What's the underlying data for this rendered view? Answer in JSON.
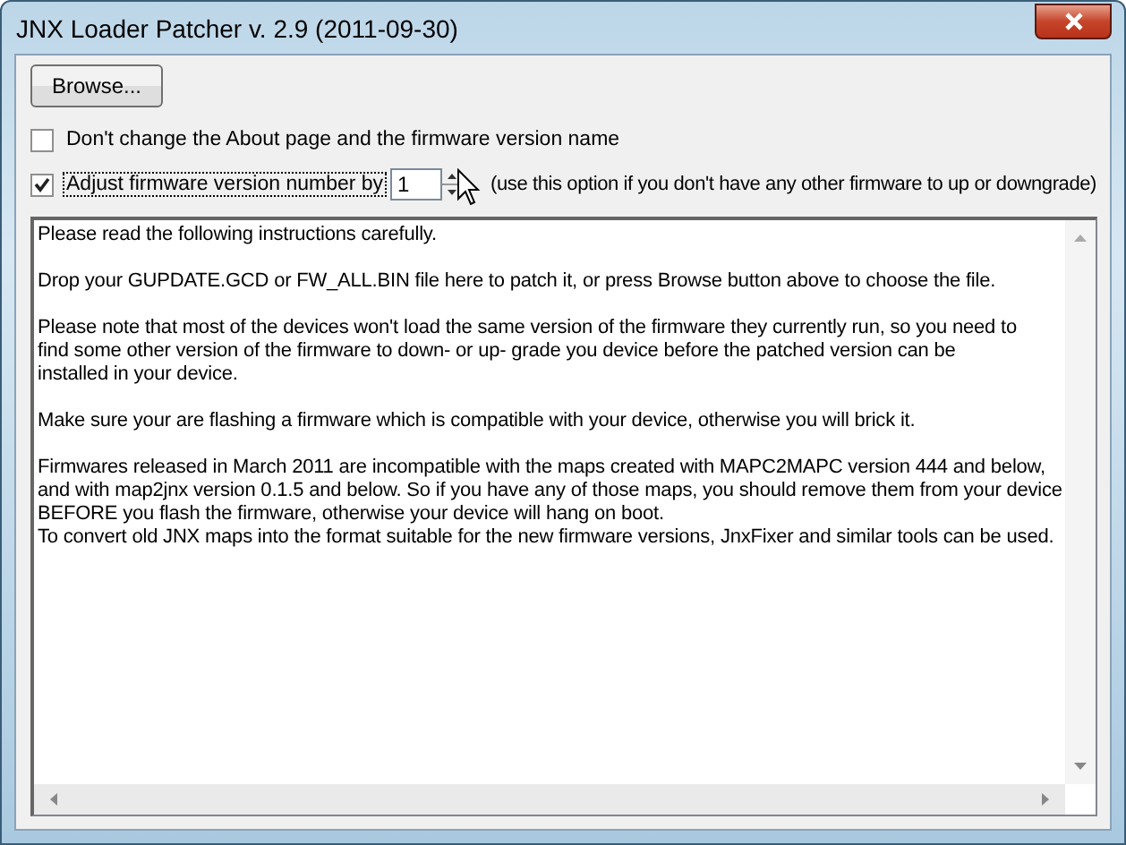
{
  "window": {
    "title": "JNX Loader Patcher v. 2.9 (2011-09-30)"
  },
  "browse_button": {
    "label": "Browse..."
  },
  "options": [
    {
      "kind": "checkbox",
      "label": "Don't change the About page and the firmware version name",
      "checked": false
    },
    {
      "kind": "spin",
      "label": "Adjust firmware version number by",
      "checked": true,
      "value": "1",
      "hint": "(use this option if you don't have any other firmware to up or downgrade)"
    }
  ],
  "instructions": [
    [
      "Please read the following instructions carefully."
    ],
    [
      "Drop your GUPDATE.GCD or FW_ALL.BIN file here to patch it, or press Browse button above to choose the file."
    ],
    [
      "Please note that most of the devices won't load the same version of the firmware they currently run, so you need to",
      "find some other version of the firmware to down- or up- grade you device before the patched version can be",
      "installed in your device."
    ],
    [
      "Make sure your are flashing a firmware which is compatible with your device, otherwise you will brick it."
    ],
    [
      "Firmwares released in March 2011 are incompatible with the maps created with MAPC2MAPC version 444 and below,",
      "and  with map2jnx version 0.1.5 and below. So if you have any of those maps, you should remove them from your device",
      "BEFORE you flash the firmware, otherwise your device will hang on boot.",
      "To convert old JNX maps into the format suitable for the new firmware versions, JnxFixer and similar tools can be used."
    ]
  ]
}
